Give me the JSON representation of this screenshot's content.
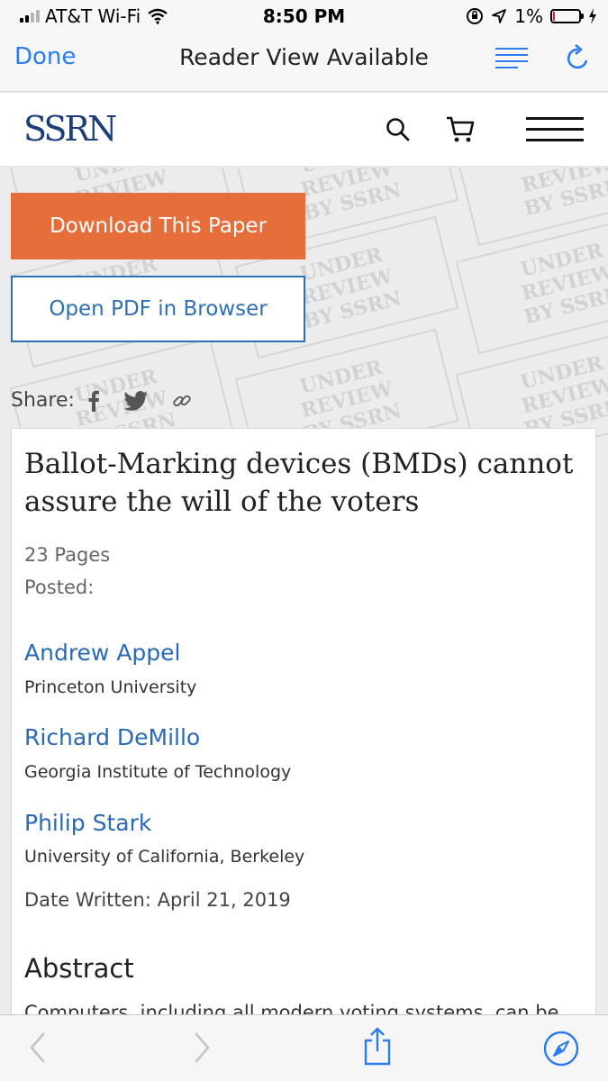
{
  "status": {
    "carrier": "AT&T Wi-Fi",
    "time": "8:50 PM",
    "battery": "1%"
  },
  "navbar": {
    "done": "Done",
    "title": "Reader View Available"
  },
  "site": {
    "logo": "SSRN"
  },
  "watermark": {
    "line1": "UNDER REVIEW",
    "line2": "BY SSRN"
  },
  "actions": {
    "download": "Download This Paper",
    "open_pdf": "Open PDF in Browser"
  },
  "share": {
    "label": "Share:"
  },
  "paper": {
    "title": "Ballot-Marking devices (BMDs) cannot assure the will of the voters",
    "pages": "23 Pages",
    "posted": "Posted:",
    "authors": [
      {
        "name": "Andrew Appel",
        "affiliation": "Princeton University"
      },
      {
        "name": "Richard DeMillo",
        "affiliation": "Georgia Institute of Technology"
      },
      {
        "name": "Philip Stark",
        "affiliation": "University of California, Berkeley"
      }
    ],
    "date_written": "Date Written: April 21, 2019",
    "abstract_heading": "Abstract",
    "abstract_text": "Computers, including all modern voting systems, can be"
  },
  "colors": {
    "ios_blue": "#2a7cf0",
    "ssrn_navy": "#1d3e7a",
    "download_orange": "#e56e3a",
    "link_blue": "#2a6ab5"
  }
}
